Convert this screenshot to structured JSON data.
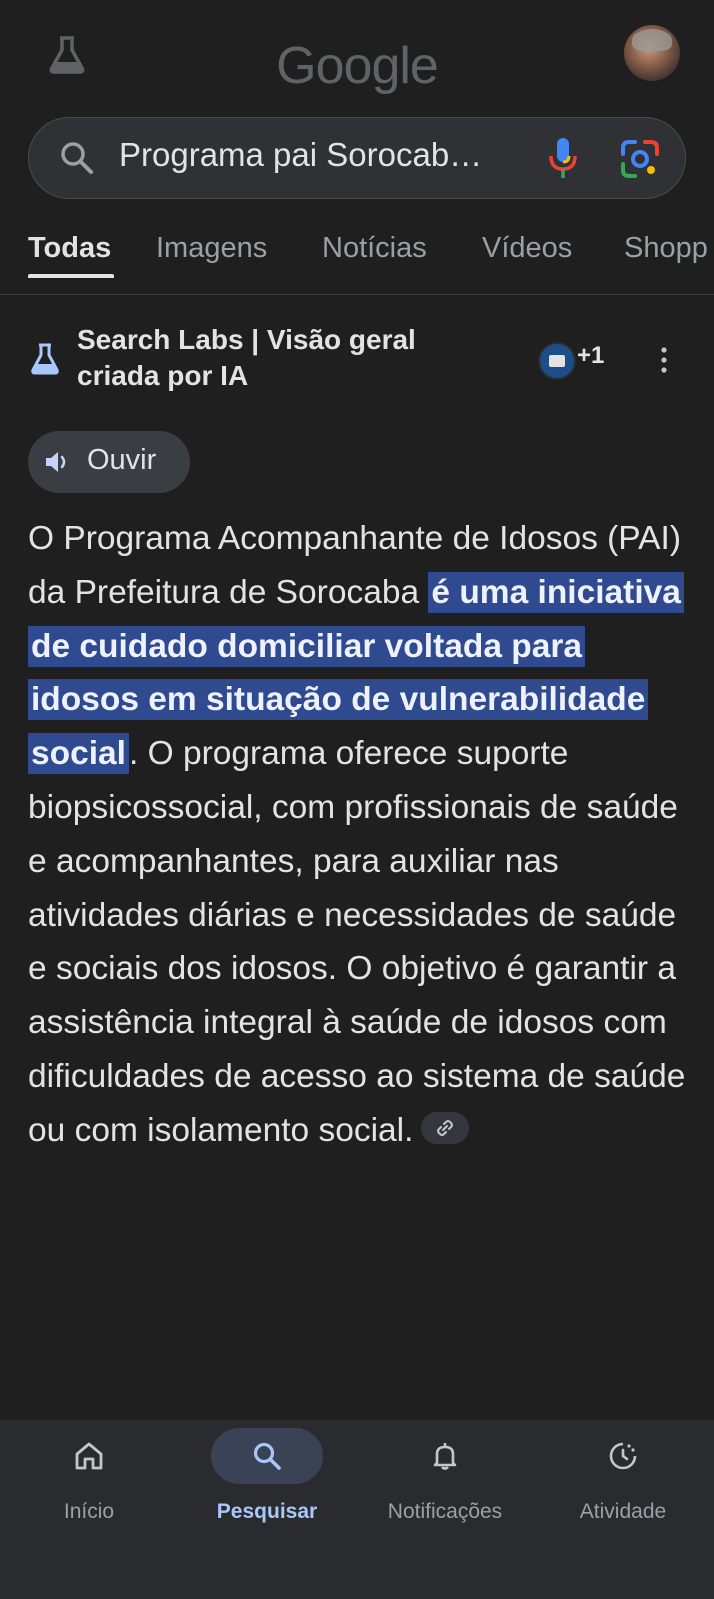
{
  "header": {
    "logo_text": "Google",
    "labs_icon": "flask-icon",
    "avatar": "user-avatar"
  },
  "search": {
    "query": "Programa pai Sorocab…",
    "icons": [
      "search-icon",
      "mic-icon",
      "lens-icon"
    ]
  },
  "tabs": [
    {
      "label": "Todas",
      "active": true
    },
    {
      "label": "Imagens",
      "active": false
    },
    {
      "label": "Notícias",
      "active": false
    },
    {
      "label": "Vídeos",
      "active": false
    },
    {
      "label": "Shopp",
      "active": false
    }
  ],
  "ai_overview": {
    "title": "Search Labs | Visão geral criada por IA",
    "contributors_extra": "+1",
    "listen_label": "Ouvir",
    "text_before": "O Programa Acompanhante de Idosos (PAI) da Prefeitura de Sorocaba ",
    "text_highlight": "é uma iniciativa de cuidado domiciliar voltada para idosos em situação de vulnerabilidade social",
    "text_after": ". O programa oferece suporte biopsicossocial, com profissionais de saúde e acompanhantes, para auxiliar nas atividades diárias e necessidades de saúde e sociais dos idosos. O objetivo é garantir a assistência integral à saúde de idosos com dificuldades de acesso ao sistema de saúde ou com isolamento social.",
    "accent_color": "#2f4a8f"
  },
  "bottom_nav": [
    {
      "label": "Início",
      "icon": "home-icon",
      "active": false
    },
    {
      "label": "Pesquisar",
      "icon": "search-icon",
      "active": true
    },
    {
      "label": "Notificações",
      "icon": "bell-icon",
      "active": false
    },
    {
      "label": "Atividade",
      "icon": "activity-icon",
      "active": false
    }
  ]
}
